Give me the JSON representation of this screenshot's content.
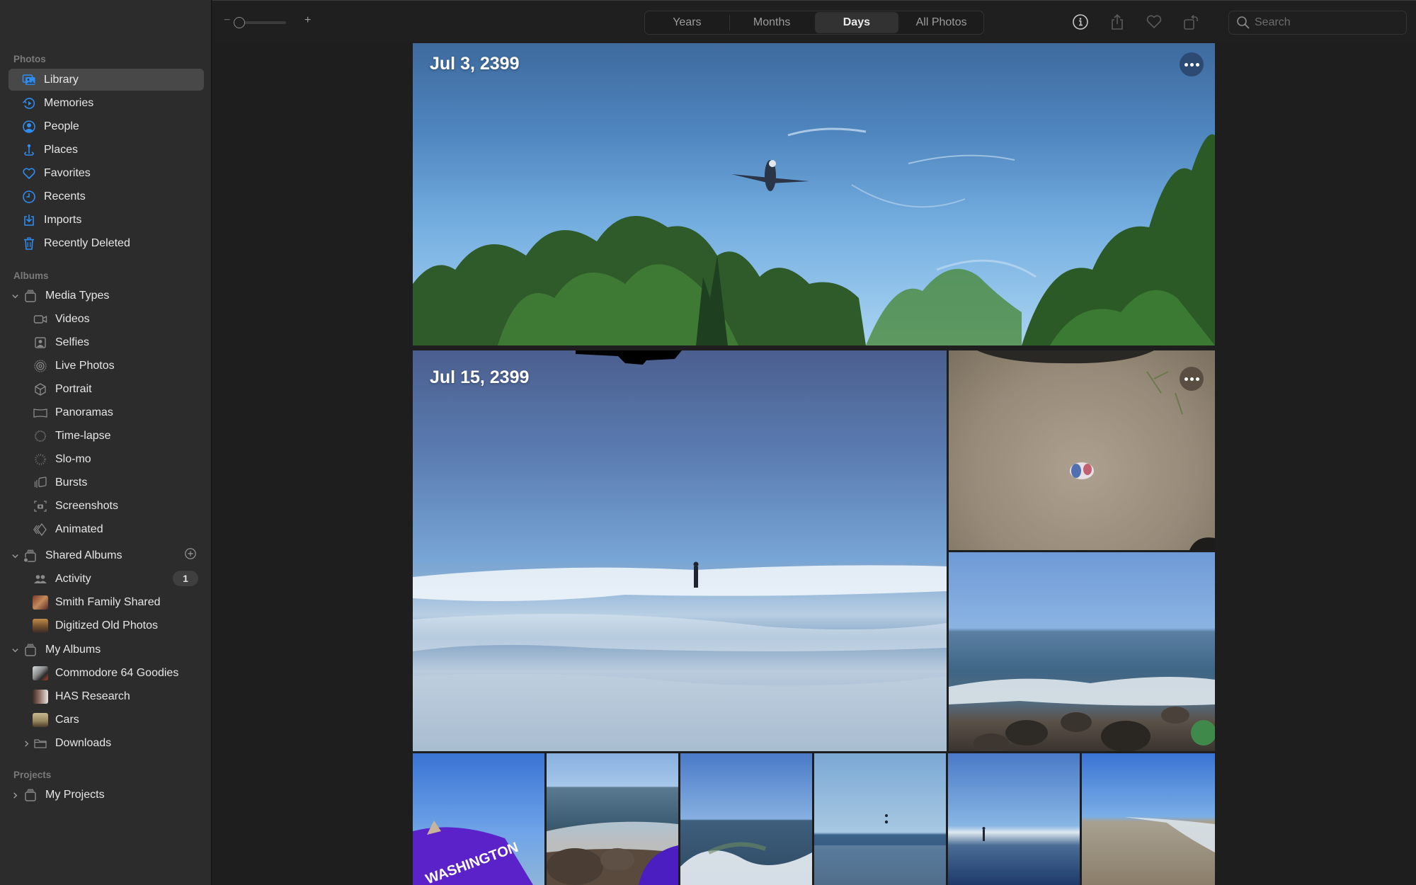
{
  "sidebar": {
    "sections": {
      "photos": "Photos",
      "albums": "Albums",
      "projects": "Projects"
    },
    "photos_items": [
      {
        "label": "Library",
        "icon": "library-icon",
        "selected": true
      },
      {
        "label": "Memories",
        "icon": "memories-icon"
      },
      {
        "label": "People",
        "icon": "people-icon"
      },
      {
        "label": "Places",
        "icon": "places-icon"
      },
      {
        "label": "Favorites",
        "icon": "favorites-icon"
      },
      {
        "label": "Recents",
        "icon": "recents-icon"
      },
      {
        "label": "Imports",
        "icon": "imports-icon"
      },
      {
        "label": "Recently Deleted",
        "icon": "trash-icon"
      }
    ],
    "media_types": {
      "label": "Media Types",
      "expanded": true,
      "items": [
        {
          "label": "Videos",
          "icon": "video-icon"
        },
        {
          "label": "Selfies",
          "icon": "selfie-icon"
        },
        {
          "label": "Live Photos",
          "icon": "live-photo-icon"
        },
        {
          "label": "Portrait",
          "icon": "portrait-cube-icon"
        },
        {
          "label": "Panoramas",
          "icon": "panorama-icon"
        },
        {
          "label": "Time-lapse",
          "icon": "timelapse-icon"
        },
        {
          "label": "Slo-mo",
          "icon": "slomo-icon"
        },
        {
          "label": "Bursts",
          "icon": "bursts-icon"
        },
        {
          "label": "Screenshots",
          "icon": "screenshot-icon"
        },
        {
          "label": "Animated",
          "icon": "animated-icon"
        }
      ]
    },
    "shared_albums": {
      "label": "Shared Albums",
      "expanded": true,
      "add_icon": "add-circle-icon",
      "items": [
        {
          "label": "Activity",
          "icon": "activity-people-icon",
          "badge": "1"
        },
        {
          "label": "Smith Family Shared",
          "icon": "album-thumbnail"
        },
        {
          "label": "Digitized Old Photos",
          "icon": "album-thumbnail"
        }
      ]
    },
    "my_albums": {
      "label": "My Albums",
      "expanded": true,
      "items": [
        {
          "label": "Commodore 64 Goodies",
          "icon": "album-thumbnail"
        },
        {
          "label": "HAS Research",
          "icon": "album-thumbnail"
        },
        {
          "label": "Cars",
          "icon": "album-thumbnail"
        },
        {
          "label": "Downloads",
          "icon": "folder-icon",
          "collapsed": true
        }
      ]
    },
    "my_projects": {
      "label": "My Projects",
      "collapsed": true
    }
  },
  "toolbar": {
    "zoom_minus": "−",
    "zoom_plus": "+",
    "zoom_level": 0.0,
    "view_tabs": [
      {
        "label": "Years"
      },
      {
        "label": "Months"
      },
      {
        "label": "Days",
        "active": true
      },
      {
        "label": "All Photos"
      }
    ],
    "actions": [
      "info-icon",
      "share-icon",
      "favorite-icon",
      "rotate-icon"
    ],
    "search": {
      "placeholder": "Search",
      "value": ""
    }
  },
  "main": {
    "days": [
      {
        "date": "Jul 3, 2399",
        "photos": [
          "Airplane over trees"
        ]
      },
      {
        "date": "Jul 15, 2399",
        "photos": [
          "Person standing in ocean waves",
          "Can on sand",
          "Rocky shoreline",
          "Washington jacket at beach",
          "Rocks and waves",
          "Waves crashing",
          "Birds over sea",
          "Person walking on beach",
          "Sandy beach"
        ]
      }
    ]
  },
  "colors": {
    "accent": "#2f8cf0",
    "sidebar_bg": "#2c2c2c",
    "selection_bg": "#484848",
    "toolbar_bg": "#1f1f1f",
    "main_bg": "#1e1e1e"
  }
}
